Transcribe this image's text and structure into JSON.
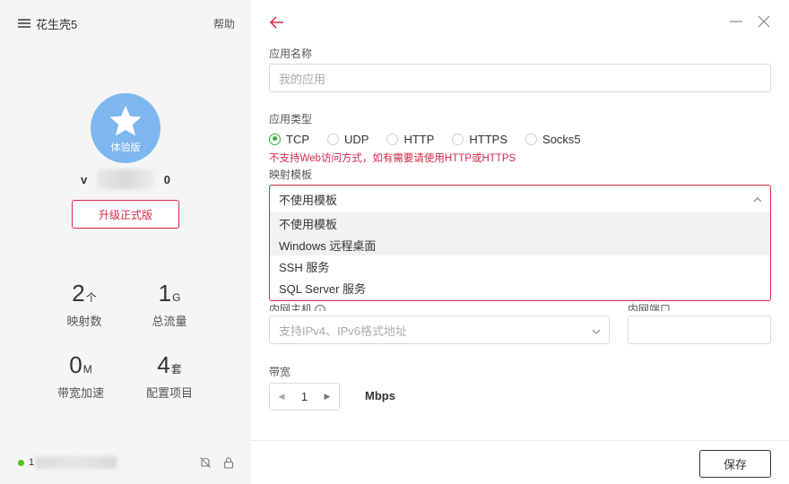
{
  "sidebar": {
    "title": "花生壳5",
    "help": "帮助",
    "avatar_badge": "体验版",
    "username_start": "v",
    "username_end": "0",
    "upgrade": "升级正式版",
    "stats": [
      {
        "value": "2",
        "unit": "个",
        "label": "映射数"
      },
      {
        "value": "1",
        "unit": "G",
        "label": "总流量"
      },
      {
        "value": "0",
        "unit": "M",
        "label": "带宽加速"
      },
      {
        "value": "4",
        "unit": "套",
        "label": "配置项目"
      }
    ],
    "footer_id": "1"
  },
  "form": {
    "app_name_label": "应用名称",
    "app_name_placeholder": "我的应用",
    "app_type_label": "应用类型",
    "app_types": [
      {
        "label": "TCP",
        "checked": true
      },
      {
        "label": "UDP",
        "checked": false
      },
      {
        "label": "HTTP",
        "checked": false
      },
      {
        "label": "HTTPS",
        "checked": false
      },
      {
        "label": "Socks5",
        "checked": false
      }
    ],
    "warning": "不支持Web访问方式，如有需要请使用HTTP或HTTPS",
    "template_label": "映射模板",
    "template_selected": "不使用模板",
    "template_options": [
      "不使用模板",
      "Windows 远程桌面",
      "SSH 服务",
      "SQL Server 服务"
    ],
    "host_label": "内网主机",
    "host_placeholder": "支持IPv4、IPv6格式地址",
    "port_label": "内网端口",
    "bandwidth_label": "带宽",
    "bandwidth_value": "1",
    "bandwidth_unit": "Mbps",
    "save": "保存"
  },
  "colors": {
    "accent": "#d7284a",
    "radio_checked": "#2db23a",
    "avatar": "#7eb6ee",
    "online": "#52c41a"
  }
}
